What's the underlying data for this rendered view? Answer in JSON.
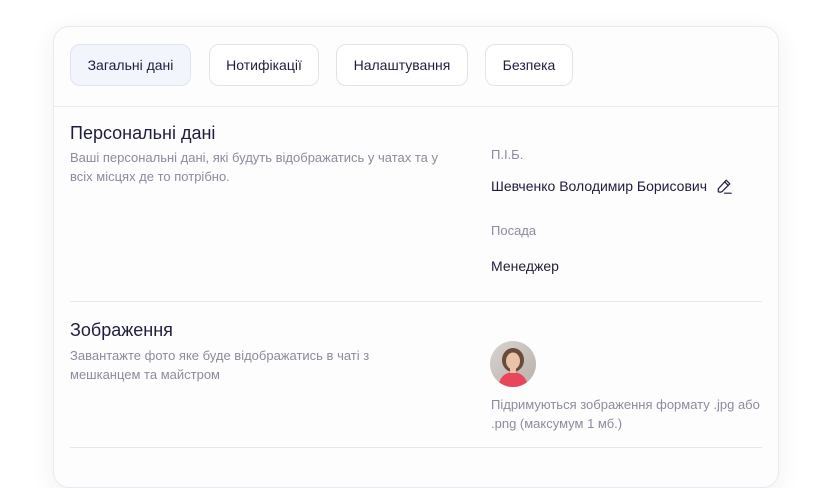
{
  "tabs": [
    {
      "label": "Загальні дані",
      "active": true
    },
    {
      "label": "Нотифікації",
      "active": false
    },
    {
      "label": "Налаштування",
      "active": false
    },
    {
      "label": "Безпека",
      "active": false
    }
  ],
  "personal": {
    "title": "Персональні дані",
    "description": "Ваші персональні дані, які будуть відображатись у чатах та у всіх місцях де то потрібно.",
    "fullname_label": "П.І.Б.",
    "fullname_value": "Шевченко Володимир Борисович",
    "position_label": "Посада",
    "position_value": "Менеджер",
    "edit_icon": "pencil-icon"
  },
  "image": {
    "title": "Зображення",
    "description": "Завантажте фото яке буде відображатись в чаті з мешканцем та майстром",
    "hint": "Підримуються зображення формату .jpg або .png (максумум 1 мб.)"
  },
  "colors": {
    "text": "#1f1d3d",
    "muted": "#8c8b9c",
    "active_tab_bg": "#f2f5fb",
    "border": "#e2e3ea"
  }
}
